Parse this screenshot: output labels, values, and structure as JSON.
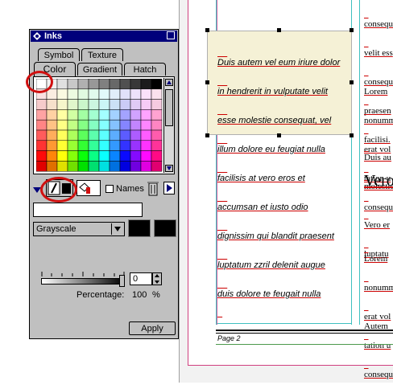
{
  "panel": {
    "title": "Inks",
    "tabs_row1": [
      "Symbol",
      "Texture"
    ],
    "tabs_row2": [
      "Color",
      "Gradient",
      "Hatch"
    ],
    "active_tab": "Color",
    "names_label": "Names",
    "mode_select": "Grayscale",
    "slider_value": "0",
    "percentage_label": "Percentage:",
    "percentage_value": "100",
    "percentage_unit": "%",
    "apply_label": "Apply",
    "name_field_value": ""
  },
  "document": {
    "frame_text_lines": [
      "Duis autem vel eum iriure dolor",
      "in hendrerit in vulputate velit",
      "esse molestie consequat, vel",
      "illum dolore eu feugiat nulla",
      "facilisis at vero eros et",
      "accumsan et iusto odio",
      "dignissim qui blandit praesent",
      "luptatum zzril delenit augue",
      "duis dolore te feugait nulla"
    ],
    "right_col_1": [
      "consequ",
      "velit ess",
      "consequ",
      "praesen",
      "facilisi."
    ],
    "right_col_2": [
      "Lorem",
      "nonumm",
      "erat vol",
      "tation u",
      "consequ"
    ],
    "right_col_3": [
      "Duis au",
      "molestie"
    ],
    "heading": "Vero",
    "right_col_4": [
      "Vero er",
      "luptatu"
    ],
    "right_col_5": [
      "Lorem",
      "nonumm",
      "erat vol",
      "tation u",
      "consequ"
    ],
    "right_col_6": [
      "Autem"
    ],
    "footer": "Page 2"
  },
  "colors": {
    "title_bar": "#00007b",
    "panel_bg": "#c0c0c0",
    "highlight_ring": "#d01010",
    "guide_cyan": "#40c0c0",
    "guide_magenta": "#d060a0",
    "frame_fill": "#f5f1d6"
  }
}
